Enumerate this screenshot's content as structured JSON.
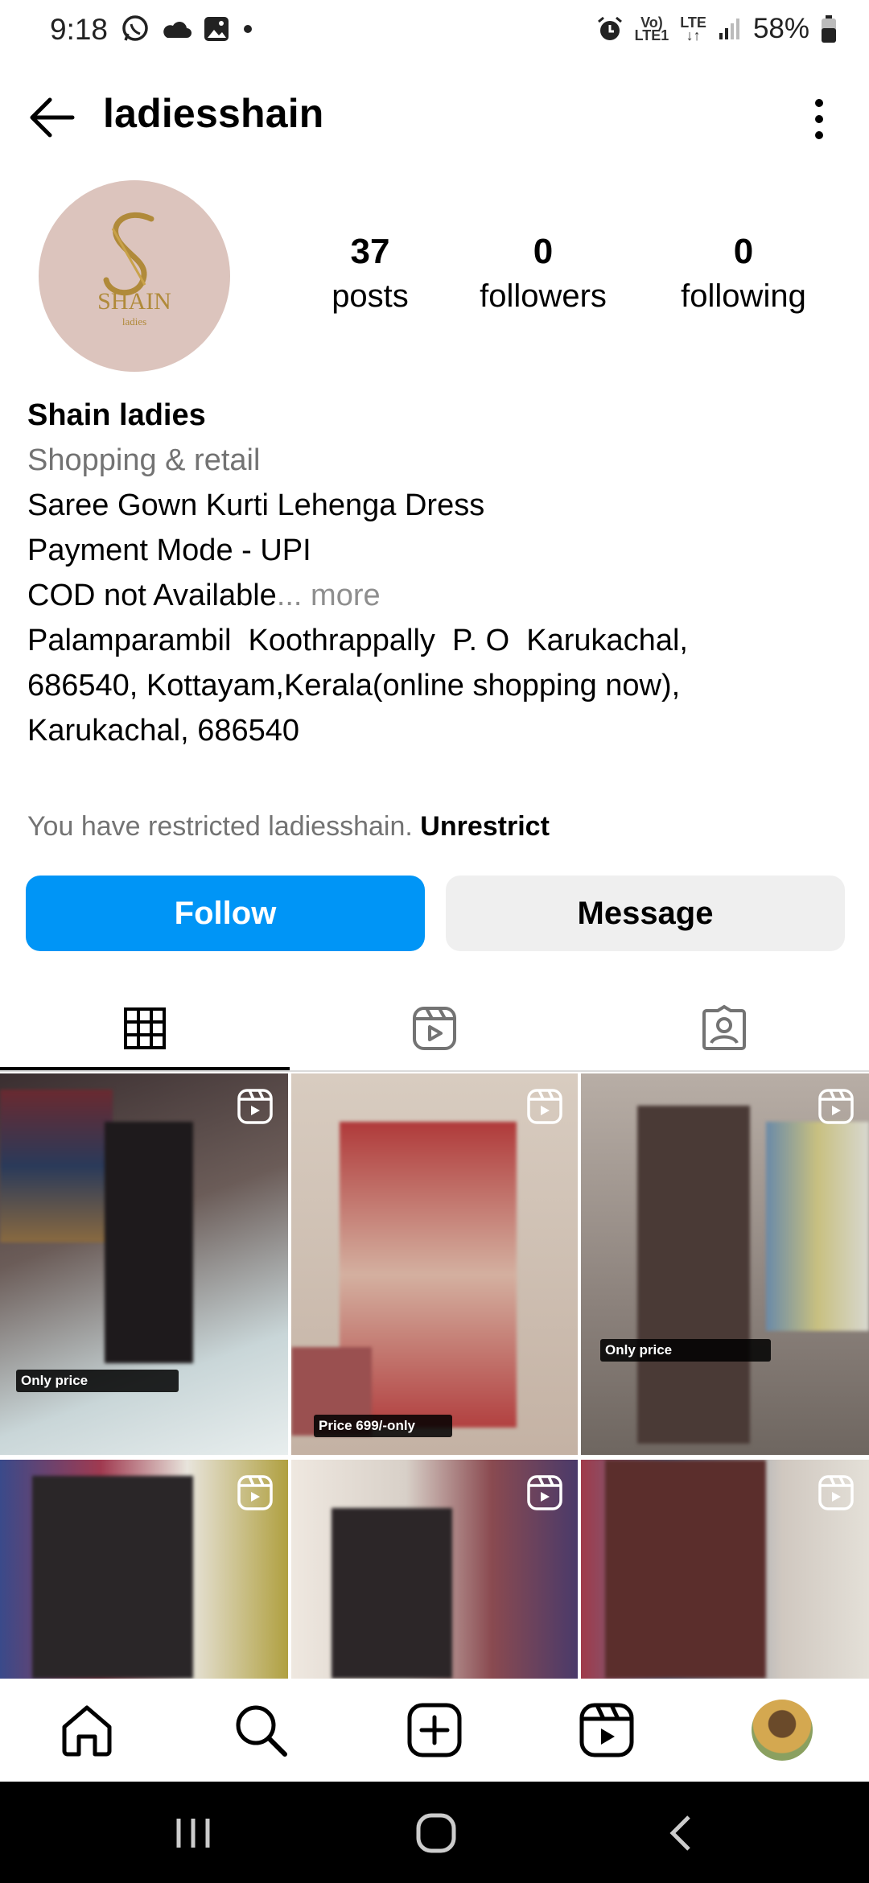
{
  "status_bar": {
    "time": "9:18",
    "volte": "Vo)",
    "lte1": "LTE1",
    "lte": "LTE",
    "battery": "58%"
  },
  "header": {
    "username": "ladiesshain"
  },
  "profile": {
    "avatar_logo": "SHAIN",
    "avatar_sub": "ladies",
    "stats": [
      {
        "value": "37",
        "label": "posts"
      },
      {
        "value": "0",
        "label": "followers"
      },
      {
        "value": "0",
        "label": "following"
      }
    ],
    "name": "Shain ladies",
    "category": "Shopping & retail",
    "bio_line1": "Saree Gown Kurti Lehenga Dress",
    "bio_line2": "Payment Mode - UPI",
    "bio_line3": "COD not Available",
    "bio_more": "... more",
    "address_line1": "Palamparambil  Koothrappally  P. O  Karukachal,",
    "address_line2": "686540, Kottayam,Kerala(online shopping now),",
    "address_line3": "Karukachal, 686540"
  },
  "restricted": {
    "text": "You have restricted ladiesshain.",
    "action": "Unrestrict"
  },
  "buttons": {
    "follow": "Follow",
    "message": "Message"
  },
  "tabs": [
    "grid-icon",
    "reels-icon",
    "tagged-icon"
  ],
  "posts": [
    {
      "label": "Only price",
      "bg": "#5a4a46"
    },
    {
      "label": "Price 699/-only",
      "bg": "#c9b8a8"
    },
    {
      "label": "Only price",
      "bg": "#8a7d74"
    },
    {
      "label": "",
      "bg": "#3c3436"
    },
    {
      "label": "",
      "bg": "#6b5450"
    },
    {
      "label": "",
      "bg": "#5b3a34"
    }
  ],
  "colors": {
    "accent": "#0095f6",
    "muted": "#737373"
  }
}
